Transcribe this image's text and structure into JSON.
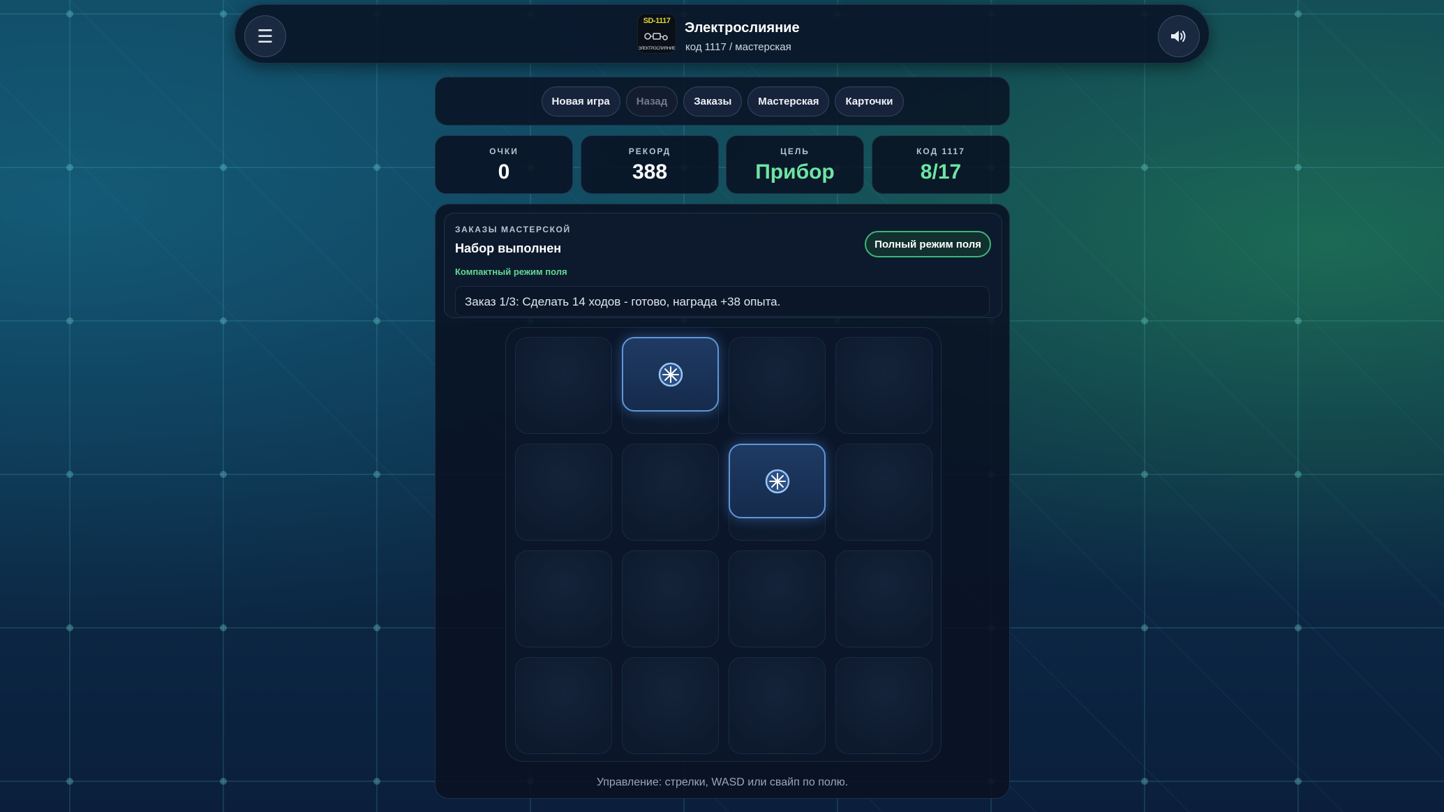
{
  "header": {
    "menu_icon": "hamburger-menu-icon",
    "logo_code": "SD-1117",
    "logo_word": "ЭЛЕКТРОСЛИЯНИЕ",
    "title": "Электрослияние",
    "subtitle": "код 1117 / мастерская",
    "sound_icon": "speaker-icon"
  },
  "nav": {
    "new_game": "Новая игра",
    "back": "Назад",
    "orders": "Заказы",
    "workshop": "Мастерская",
    "cards": "Карточки"
  },
  "stats": {
    "score": {
      "label": "ОЧКИ",
      "value": "0"
    },
    "record": {
      "label": "РЕКОРД",
      "value": "388"
    },
    "goal": {
      "label": "ЦЕЛЬ",
      "value": "Прибор"
    },
    "code": {
      "label": "КОД 1117",
      "value": "8/17"
    }
  },
  "orders": {
    "eyebrow": "ЗАКАЗЫ МАСТЕРСКОЙ",
    "title": "Набор выполнен",
    "mode": "Компактный режим поля",
    "full_mode_button": "Полный режим поля",
    "line": "Заказ 1/3: Сделать 14 ходов - готово, награда +38 опыта."
  },
  "board": {
    "rows": 4,
    "cols": 4,
    "tiles": [
      {
        "row": 0,
        "col": 1,
        "icon": "spark-icon"
      },
      {
        "row": 1,
        "col": 2,
        "icon": "spark-icon"
      }
    ]
  },
  "hint": "Управление: стрелки, WASD или свайп по полю.",
  "colors": {
    "accent_green": "#6ee4a4",
    "tile_border": "#5f96d8",
    "panel_bg": "#09132a"
  }
}
